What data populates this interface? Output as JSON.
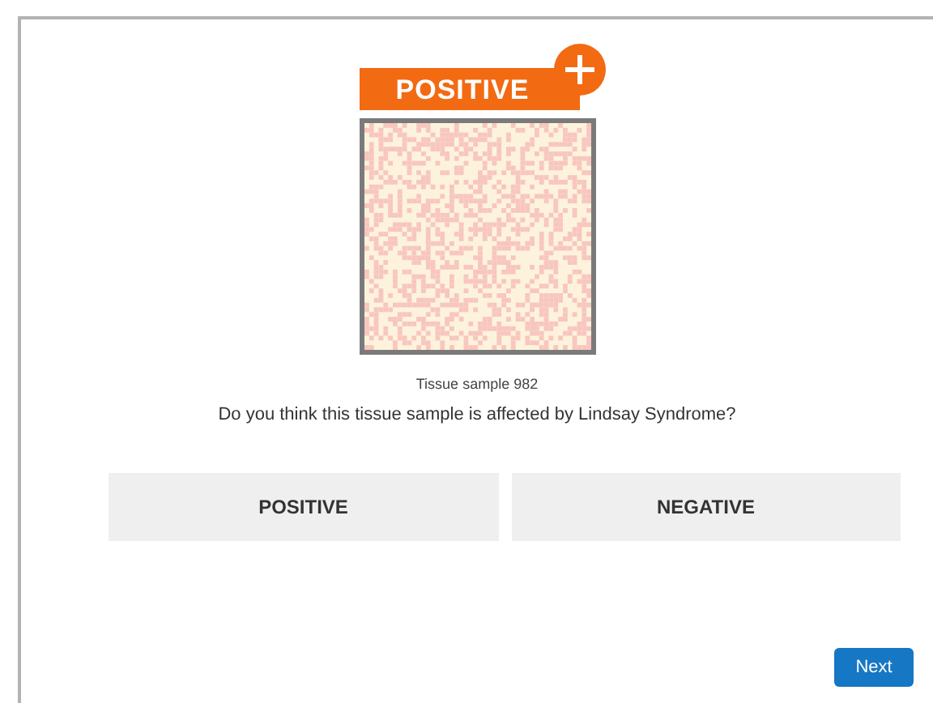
{
  "badge": {
    "label": "POSITIVE"
  },
  "sample": {
    "caption": "Tissue sample 982"
  },
  "question": "Do you think this tissue sample is affected by Lindsay Syndrome?",
  "answers": [
    {
      "label": "POSITIVE",
      "selected": false
    },
    {
      "label": "NEGATIVE",
      "selected": false
    }
  ],
  "next_button": {
    "label": "Next"
  }
}
